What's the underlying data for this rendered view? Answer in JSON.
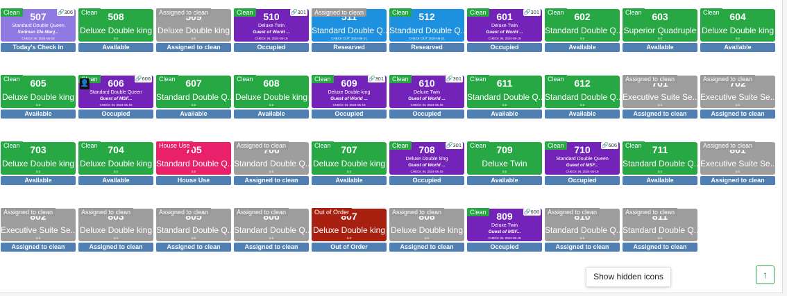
{
  "colors": {
    "clean_badge": "#28a745",
    "assigned_badge": "#999999",
    "house_use_badge": "#e8216a",
    "out_of_order_badge": "#a82010",
    "available_tile": "#28a745",
    "assigned_tile": "#9e9e9e",
    "occupied_tile": "#7323b7",
    "reserved_tile": "#1e90e0",
    "checkin_tile": "#8f79e3",
    "house_use_tile": "#e8216a",
    "out_of_order_tile": "#a82010",
    "status_bar": "#4f7fb3"
  },
  "rooms": [
    {
      "number": "507",
      "hk": "Clean",
      "hk_color": "#28a745",
      "tile_color": "#8f79e3",
      "layout": "small",
      "type": "Standard Double Queen",
      "guest": "Sodman Ele Manj...",
      "meta": "CHECK IN: 2024-05-20",
      "link": "306",
      "status": "Today's Check In"
    },
    {
      "number": "508",
      "hk": "Clean",
      "hk_color": "#28a745",
      "tile_color": "#28a745",
      "layout": "big",
      "type": "Deluxe Double king",
      "meta": "0.0",
      "status": "Available"
    },
    {
      "number": "509",
      "hk": "Assigned to clean",
      "hk_color": "#999999",
      "tile_color": "#9e9e9e",
      "layout": "big",
      "type": "Deluxe Double king",
      "meta": "0.0",
      "status": "Assigned to clean"
    },
    {
      "number": "510",
      "hk": "Clean",
      "hk_color": "#28a745",
      "tile_color": "#7323b7",
      "layout": "small",
      "type": "Deluxe Twin",
      "guest": "Guest of World ...",
      "meta": "CHECK IN: 2024-05-19",
      "link": "301",
      "status": "Occupied"
    },
    {
      "number": "511",
      "hk": "Assigned to clean",
      "hk_color": "#999999",
      "tile_color": "#1e90e0",
      "layout": "big",
      "type": "Standard Double Q...",
      "meta": "CHECK OUT: 2024-05-21",
      "status": "Researved"
    },
    {
      "number": "512",
      "hk": "Clean",
      "hk_color": "#28a745",
      "tile_color": "#1e90e0",
      "layout": "big",
      "type": "Standard Double Q...",
      "meta": "CHECK OUT: 2024-05-21",
      "status": "Researved"
    },
    {
      "number": "601",
      "hk": "Clean",
      "hk_color": "#28a745",
      "tile_color": "#7323b7",
      "layout": "small",
      "type": "Deluxe Twin",
      "guest": "Guest of World ...",
      "meta": "CHECK IN: 2024-05-19",
      "link": "301",
      "status": "Occupied"
    },
    {
      "number": "602",
      "hk": "Clean",
      "hk_color": "#28a745",
      "tile_color": "#28a745",
      "layout": "big",
      "type": "Standard Double Q...",
      "meta": "0.0",
      "status": "Available"
    },
    {
      "number": "603",
      "hk": "Clean",
      "hk_color": "#28a745",
      "tile_color": "#28a745",
      "layout": "big",
      "type": "Superior Quadruple",
      "meta": "0.0",
      "status": "Available"
    },
    {
      "number": "604",
      "hk": "Clean",
      "hk_color": "#28a745",
      "tile_color": "#28a745",
      "layout": "big",
      "type": "Deluxe Double king",
      "meta": "0.0",
      "status": "Available"
    },
    {
      "number": "605",
      "hk": "Clean",
      "hk_color": "#28a745",
      "tile_color": "#28a745",
      "layout": "big",
      "type": "Deluxe Double king",
      "meta": "0.0",
      "status": "Available"
    },
    {
      "number": "606",
      "hk": "Clean",
      "hk_color": "#28a745",
      "tile_color": "#7323b7",
      "layout": "small",
      "type": "Standard Double Queen",
      "guest": "Guest of MSF...",
      "meta": "CHECK IN: 2024-05-19",
      "link": "606",
      "avatar": "user-icon",
      "status": "Occupied"
    },
    {
      "number": "607",
      "hk": "Clean",
      "hk_color": "#28a745",
      "tile_color": "#28a745",
      "layout": "big",
      "type": "Standard Double Q...",
      "meta": "0.0",
      "status": "Available"
    },
    {
      "number": "608",
      "hk": "Clean",
      "hk_color": "#28a745",
      "tile_color": "#28a745",
      "layout": "big",
      "type": "Deluxe Double king",
      "meta": "0.0",
      "status": "Available"
    },
    {
      "number": "609",
      "hk": "Clean",
      "hk_color": "#28a745",
      "tile_color": "#7323b7",
      "layout": "small",
      "type": "Deluxe Double king",
      "guest": "Guest of World ...",
      "meta": "CHECK IN: 2024-05-19",
      "link": "301",
      "status": "Occupied"
    },
    {
      "number": "610",
      "hk": "Clean",
      "hk_color": "#28a745",
      "tile_color": "#7323b7",
      "layout": "small",
      "type": "Deluxe Twin",
      "guest": "Guest of World ...",
      "meta": "CHECK IN: 2024-05-19",
      "link": "301",
      "status": "Occupied"
    },
    {
      "number": "611",
      "hk": "Clean",
      "hk_color": "#28a745",
      "tile_color": "#28a745",
      "layout": "big",
      "type": "Standard Double Q...",
      "meta": "0.0",
      "status": "Available"
    },
    {
      "number": "612",
      "hk": "Clean",
      "hk_color": "#28a745",
      "tile_color": "#28a745",
      "layout": "big",
      "type": "Standard Double Q...",
      "meta": "0.0",
      "status": "Available"
    },
    {
      "number": "701",
      "hk": "Assigned to clean",
      "hk_color": "#999999",
      "tile_color": "#9e9e9e",
      "layout": "big",
      "type": "Executive Suite Se...",
      "meta": "0.0",
      "status": "Assigned to clean"
    },
    {
      "number": "702",
      "hk": "Assigned to clean",
      "hk_color": "#999999",
      "tile_color": "#9e9e9e",
      "layout": "big",
      "type": "Executive Suite Se...",
      "meta": "0.0",
      "status": "Assigned to clean"
    },
    {
      "number": "703",
      "hk": "Clean",
      "hk_color": "#28a745",
      "tile_color": "#28a745",
      "layout": "big",
      "type": "Deluxe Double king",
      "meta": "0.0",
      "status": "Available"
    },
    {
      "number": "704",
      "hk": "Clean",
      "hk_color": "#28a745",
      "tile_color": "#28a745",
      "layout": "big",
      "type": "Deluxe Double king",
      "meta": "0.0",
      "status": "Available"
    },
    {
      "number": "705",
      "hk": "House Use",
      "hk_color": "#e8216a",
      "tile_color": "#e8216a",
      "layout": "big",
      "type": "Standard Double Q...",
      "meta": "0.0",
      "status": "House Use"
    },
    {
      "number": "706",
      "hk": "Assigned to clean",
      "hk_color": "#999999",
      "tile_color": "#9e9e9e",
      "layout": "big",
      "type": "Standard Double Q...",
      "meta": "0.0",
      "status": "Assigned to clean"
    },
    {
      "number": "707",
      "hk": "Clean",
      "hk_color": "#28a745",
      "tile_color": "#28a745",
      "layout": "big",
      "type": "Deluxe Double king",
      "meta": "0.0",
      "status": "Available"
    },
    {
      "number": "708",
      "hk": "Clean",
      "hk_color": "#28a745",
      "tile_color": "#7323b7",
      "layout": "small",
      "type": "Deluxe Double king",
      "guest": "Guest of World ...",
      "meta": "CHECK IN: 2024-05-19",
      "link": "301",
      "status": "Occupied"
    },
    {
      "number": "709",
      "hk": "Clean",
      "hk_color": "#28a745",
      "tile_color": "#28a745",
      "layout": "big",
      "type": "Deluxe Twin",
      "meta": "0.0",
      "status": "Available"
    },
    {
      "number": "710",
      "hk": "Clean",
      "hk_color": "#28a745",
      "tile_color": "#7323b7",
      "layout": "small",
      "type": "Standard Double Queen",
      "guest": "Guest of MSF...",
      "meta": "CHECK IN: 2024-05-19",
      "link": "606",
      "status": "Occupied"
    },
    {
      "number": "711",
      "hk": "Clean",
      "hk_color": "#28a745",
      "tile_color": "#28a745",
      "layout": "big",
      "type": "Standard Double Q...",
      "meta": "0.0",
      "status": "Available"
    },
    {
      "number": "801",
      "hk": "Assigned to clean",
      "hk_color": "#999999",
      "tile_color": "#9e9e9e",
      "layout": "big",
      "type": "Executive Suite Se...",
      "meta": "0.0",
      "status": "Assigned to clean"
    },
    {
      "number": "802",
      "hk": "Assigned to clean",
      "hk_color": "#999999",
      "tile_color": "#9e9e9e",
      "layout": "big",
      "type": "Executive Suite Se...",
      "meta": "0.0",
      "status": "Assigned to clean"
    },
    {
      "number": "803",
      "hk": "Assigned to clean",
      "hk_color": "#999999",
      "tile_color": "#9e9e9e",
      "layout": "big",
      "type": "Deluxe Double king",
      "meta": "0.0",
      "status": "Assigned to clean"
    },
    {
      "number": "805",
      "hk": "Assigned to clean",
      "hk_color": "#999999",
      "tile_color": "#9e9e9e",
      "layout": "big",
      "type": "Standard Double Q...",
      "meta": "0.0",
      "status": "Assigned to clean"
    },
    {
      "number": "806",
      "hk": "Assigned to clean",
      "hk_color": "#999999",
      "tile_color": "#9e9e9e",
      "layout": "big",
      "type": "Standard Double Q...",
      "meta": "0.0",
      "status": "Assigned to clean"
    },
    {
      "number": "807",
      "hk": "Out of Order",
      "hk_color": "#a82010",
      "tile_color": "#a82010",
      "layout": "big",
      "type": "Deluxe Double king",
      "meta": "0.0",
      "status": "Out of Order"
    },
    {
      "number": "808",
      "hk": "Assigned to clean",
      "hk_color": "#999999",
      "tile_color": "#9e9e9e",
      "layout": "big",
      "type": "Deluxe Double king",
      "meta": "0.0",
      "status": "Assigned to clean"
    },
    {
      "number": "809",
      "hk": "Clean",
      "hk_color": "#28a745",
      "tile_color": "#7323b7",
      "layout": "small",
      "type": "Deluxe Twin",
      "guest": "Guest of MSF...",
      "meta": "CHECK IN: 2024-05-19",
      "link": "606",
      "status": "Occupied"
    },
    {
      "number": "810",
      "hk": "Assigned to clean",
      "hk_color": "#999999",
      "tile_color": "#9e9e9e",
      "layout": "big",
      "type": "Standard Double Q...",
      "meta": "0.0",
      "status": "Assigned to clean"
    },
    {
      "number": "811",
      "hk": "Assigned to clean",
      "hk_color": "#999999",
      "tile_color": "#9e9e9e",
      "layout": "big",
      "type": "Standard Double Q...",
      "meta": "0.0",
      "status": "Assigned to clean"
    }
  ],
  "tooltip": {
    "text": "Show hidden icons"
  },
  "scroll_top": {
    "icon": "arrow-up-icon",
    "glyph": "↑"
  },
  "link_glyph": "🔗",
  "avatar_glyph": "👤"
}
